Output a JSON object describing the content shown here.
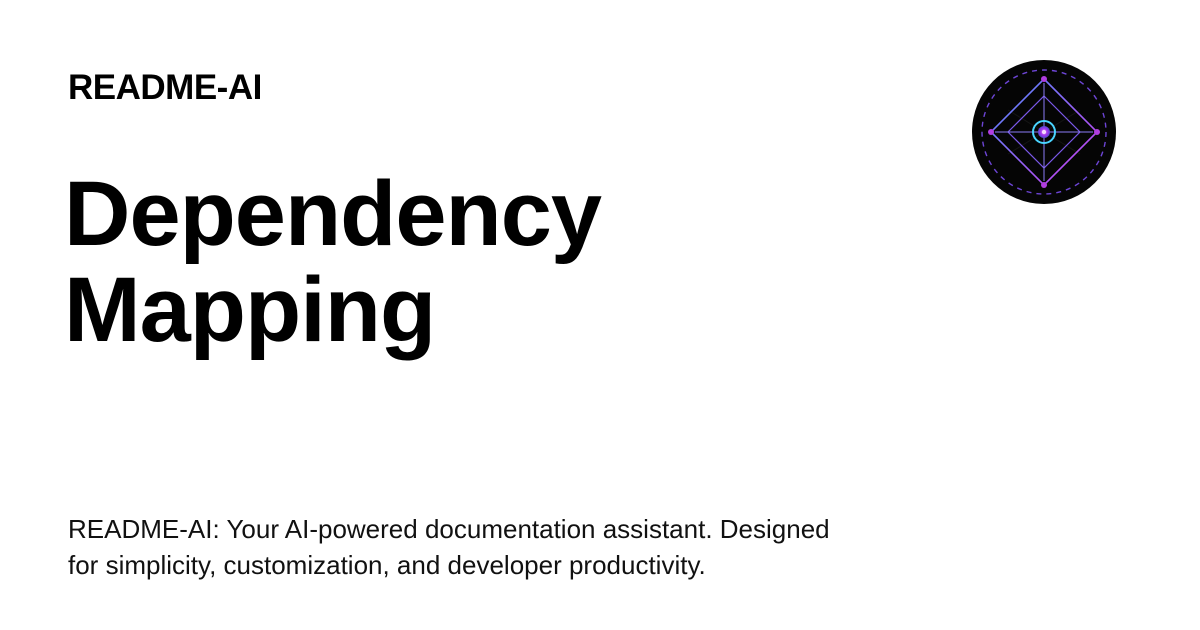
{
  "header": {
    "site_name": "README-AI"
  },
  "title": {
    "line1": "Dependency",
    "line2": "Mapping"
  },
  "description": {
    "line1": "README-AI: Your AI-powered documentation assistant. Designed",
    "line2": "for simplicity, customization, and developer productivity."
  },
  "logo": {
    "icon": "readme-ai-logo-icon",
    "colors": {
      "background": "#050505",
      "blue": "#3f7ee8",
      "purple": "#b13de0",
      "magenta": "#d13cf0",
      "cyan": "#4ad3ff"
    }
  }
}
